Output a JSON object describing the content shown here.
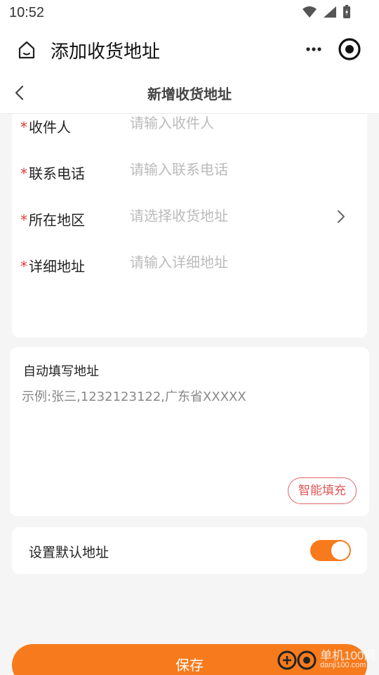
{
  "status_bar": {
    "time": "10:52"
  },
  "app_bar": {
    "title": "添加收货地址"
  },
  "nav": {
    "title": "新增收货地址"
  },
  "form": {
    "required_mark": "*",
    "fields": [
      {
        "label": "收件人",
        "placeholder": "请输入收件人",
        "value": ""
      },
      {
        "label": "联系电话",
        "placeholder": "请输入联系电话",
        "value": ""
      },
      {
        "label": "所在地区",
        "placeholder": "请选择收货地址",
        "value": ""
      },
      {
        "label": "详细地址",
        "placeholder": "请输入详细地址",
        "value": ""
      }
    ]
  },
  "autofill": {
    "title": "自动填写地址",
    "placeholder": "示例:张三,1232123122,广东省XXXXX",
    "button_label": "智能填充"
  },
  "default_address": {
    "label": "设置默认地址",
    "enabled": true
  },
  "save_label": "保存",
  "watermark": {
    "text": "单机100网",
    "sub": "danji100.com"
  },
  "colors": {
    "accent": "#f77b1c",
    "required": "#e53935",
    "smart_button": "#e05555"
  },
  "icons": [
    "home-icon",
    "more-icon",
    "target-icon",
    "back-icon",
    "chevron-right-icon",
    "wifi-icon",
    "signal-icon",
    "battery-icon"
  ]
}
